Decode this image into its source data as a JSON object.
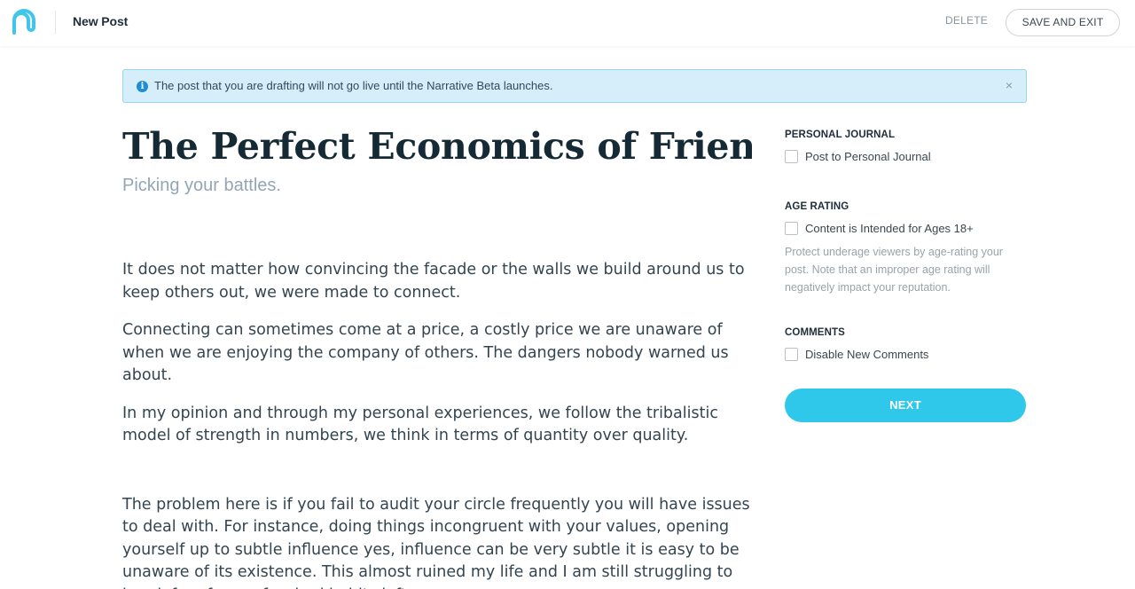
{
  "header": {
    "page_title": "New Post",
    "delete_label": "DELETE",
    "save_exit_label": "SAVE AND EXIT"
  },
  "banner": {
    "icon": "info-icon",
    "message": "The post that you are drafting will not go live until the Narrative Beta launches.",
    "close_glyph": "×"
  },
  "post": {
    "title": "The Perfect Economics of Friendships",
    "subtitle": "Picking your battles.",
    "paragraphs": [
      "It does not matter how convincing the facade or the walls we build around us to keep others out, we were made to connect.",
      "Connecting can sometimes come at a price, a costly price we are unaware of when we are enjoying the company of others. The dangers nobody warned us about.",
      "In my opinion and through my personal experiences, we follow the tribalistic model of strength in numbers, we think in terms of quantity over quality.",
      "The problem here is if you fail to audit your circle frequently you will have issues to deal with. For instance, doing things incongruent with your values, opening yourself up to subtle influence yes, influence can be very subtle it is easy to be unaware of its existence. This almost ruined my life and I am still struggling to break free from a few bad habits left."
    ]
  },
  "sidebar": {
    "personal_journal": {
      "title": "PERSONAL JOURNAL",
      "checkbox_label": "Post to Personal Journal",
      "checked": false
    },
    "age_rating": {
      "title": "AGE RATING",
      "checkbox_label": "Content is Intended for Ages 18+",
      "checked": false,
      "help": "Protect underage viewers by age-rating your post. Note that an improper age rating will negatively impact your reputation."
    },
    "comments": {
      "title": "COMMENTS",
      "checkbox_label": "Disable New Comments",
      "checked": false
    },
    "next_label": "NEXT"
  },
  "colors": {
    "accent": "#30c8ea",
    "banner_bg": "#d6eef9",
    "banner_border": "#98d4ee",
    "info_icon": "#1d8ed4"
  }
}
